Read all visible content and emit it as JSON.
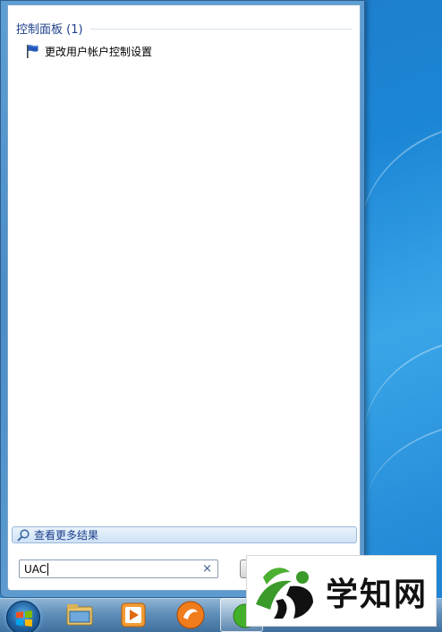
{
  "start_menu": {
    "group_title": "控制面板 (1)",
    "results": [
      {
        "label": "更改用户帐户控制设置",
        "icon": "uac-flag-icon"
      }
    ],
    "see_more_label": "查看更多结果",
    "search": {
      "value": "UAC",
      "clear_icon": "×"
    }
  },
  "watermark": {
    "text": "学知网"
  },
  "colors": {
    "group_title": "#1e3f8c",
    "desktop_blue": "#1c86d6",
    "start_menu_frame": "#4c8dc7"
  }
}
